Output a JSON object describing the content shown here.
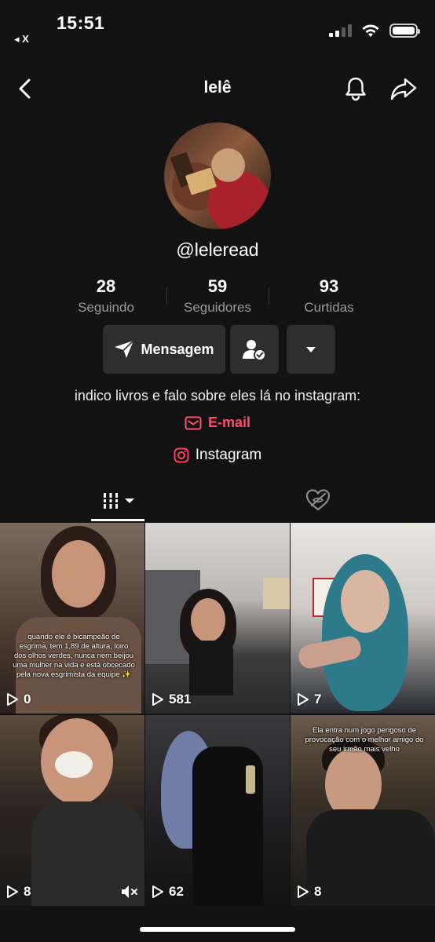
{
  "status_bar": {
    "time": "15:51",
    "back_app": "◂ X"
  },
  "nav": {
    "title": "lelê"
  },
  "profile": {
    "username": "@leleread",
    "stats": [
      {
        "value": "28",
        "label": "Seguindo"
      },
      {
        "value": "59",
        "label": "Seguidores"
      },
      {
        "value": "93",
        "label": "Curtidas"
      }
    ],
    "message_button": "Mensagem",
    "bio": "indico livros e falo sobre eles lá no instagram:",
    "email_link": "E-mail",
    "instagram_link": "Instagram"
  },
  "colors": {
    "accent": "#ff4d6d",
    "background": "#121212",
    "button_bg": "#2e2e2e"
  },
  "videos": [
    {
      "views": "0",
      "caption": "quando ele é bicampeão de esgrima, tem 1,89 de altura, loiro dos olhos verdes, nunca nem beijou uma mulher na vida e está obcecado pela nova esgrimista da equipe ✨"
    },
    {
      "views": "581",
      "caption": ""
    },
    {
      "views": "7",
      "caption": ""
    },
    {
      "views": "8",
      "caption": ""
    },
    {
      "views": "62",
      "caption": ""
    },
    {
      "views": "8",
      "caption": "Ela entra num jogo perigoso de provocação com o melhor amigo do seu irmão mais velho"
    }
  ]
}
